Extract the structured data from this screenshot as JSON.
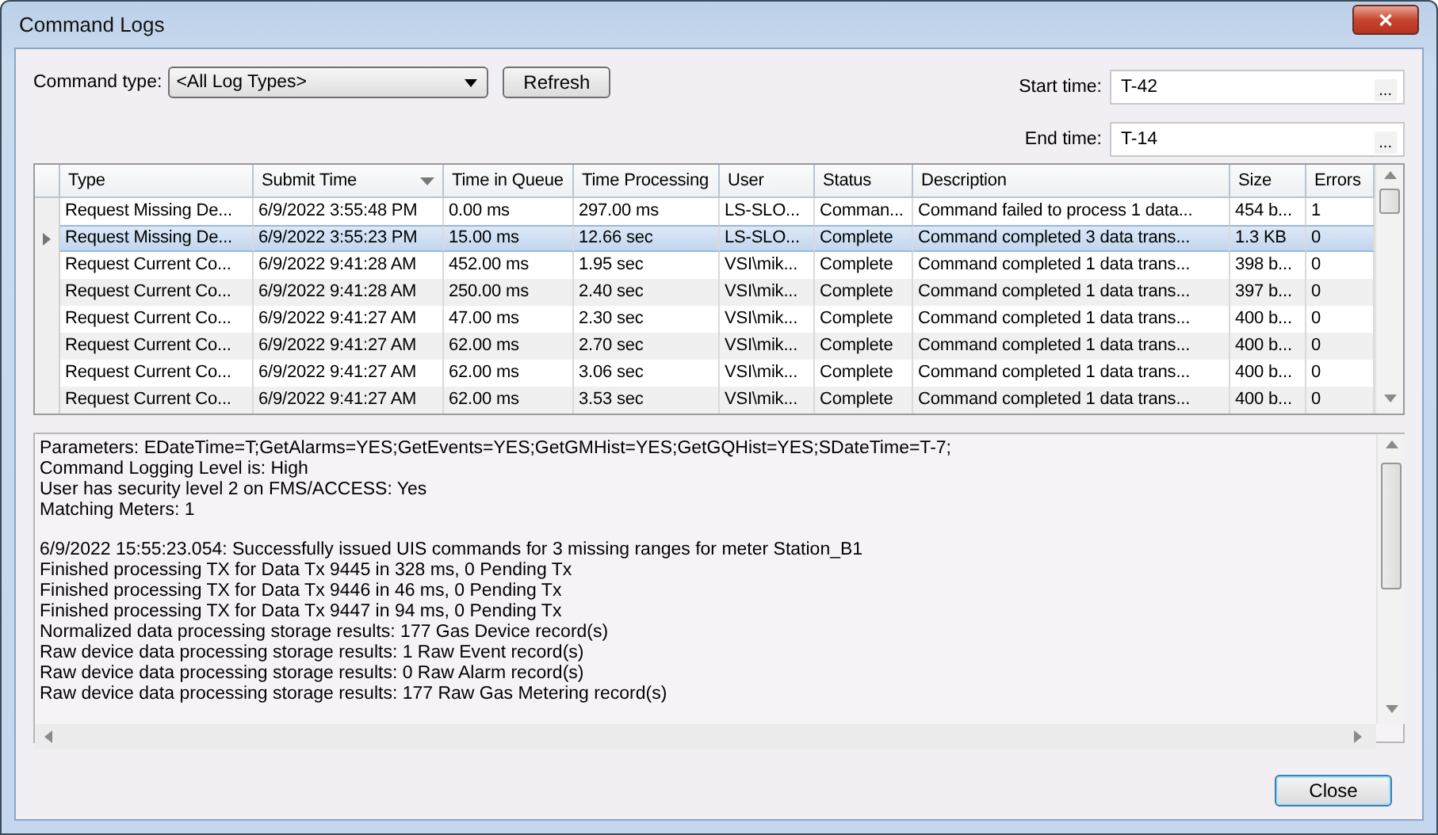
{
  "window": {
    "title": "Command Logs",
    "close_label": "✕"
  },
  "filters": {
    "command_type_label": "Command type:",
    "command_type_value": "<All Log Types>",
    "refresh": "Refresh",
    "start_label": "Start time:",
    "start_value": "T-42",
    "end_label": "End time:",
    "end_value": "T-14",
    "picker_label": "..."
  },
  "table": {
    "columns": [
      {
        "label": "Type",
        "sorted": false
      },
      {
        "label": "Submit Time",
        "sorted": true
      },
      {
        "label": "Time in Queue",
        "sorted": false
      },
      {
        "label": "Time Processing",
        "sorted": false
      },
      {
        "label": "User",
        "sorted": false
      },
      {
        "label": "Status",
        "sorted": false
      },
      {
        "label": "Description",
        "sorted": false
      },
      {
        "label": "Size",
        "sorted": false
      },
      {
        "label": "Errors",
        "sorted": false
      }
    ],
    "rows": [
      {
        "selected": false,
        "cells": [
          "Request Missing De...",
          "6/9/2022 3:55:48 PM",
          "0.00 ms",
          "297.00 ms",
          "LS-SLO...",
          "Comman...",
          "Command failed to process 1 data...",
          "454 b...",
          "1"
        ]
      },
      {
        "selected": true,
        "cells": [
          "Request Missing De...",
          "6/9/2022 3:55:23 PM",
          "15.00 ms",
          "12.66 sec",
          "LS-SLO...",
          "Complete",
          "Command completed 3 data trans...",
          "1.3 KB",
          "0"
        ]
      },
      {
        "selected": false,
        "cells": [
          "Request Current Co...",
          "6/9/2022 9:41:28 AM",
          "452.00 ms",
          "1.95 sec",
          "VSI\\mik...",
          "Complete",
          "Command completed 1 data trans...",
          "398 b...",
          "0"
        ]
      },
      {
        "selected": false,
        "cells": [
          "Request Current Co...",
          "6/9/2022 9:41:28 AM",
          "250.00 ms",
          "2.40 sec",
          "VSI\\mik...",
          "Complete",
          "Command completed 1 data trans...",
          "397 b...",
          "0"
        ]
      },
      {
        "selected": false,
        "cells": [
          "Request Current Co...",
          "6/9/2022 9:41:27 AM",
          "47.00 ms",
          "2.30 sec",
          "VSI\\mik...",
          "Complete",
          "Command completed 1 data trans...",
          "400 b...",
          "0"
        ]
      },
      {
        "selected": false,
        "cells": [
          "Request Current Co...",
          "6/9/2022 9:41:27 AM",
          "62.00 ms",
          "2.70 sec",
          "VSI\\mik...",
          "Complete",
          "Command completed 1 data trans...",
          "400 b...",
          "0"
        ]
      },
      {
        "selected": false,
        "cells": [
          "Request Current Co...",
          "6/9/2022 9:41:27 AM",
          "62.00 ms",
          "3.06 sec",
          "VSI\\mik...",
          "Complete",
          "Command completed 1 data trans...",
          "400 b...",
          "0"
        ]
      },
      {
        "selected": false,
        "cells": [
          "Request Current Co...",
          "6/9/2022 9:41:27 AM",
          "62.00 ms",
          "3.53 sec",
          "VSI\\mik...",
          "Complete",
          "Command completed 1 data trans...",
          "400 b...",
          "0"
        ]
      }
    ]
  },
  "log": {
    "paragraphs": [
      [
        "Parameters: EDateTime=T;GetAlarms=YES;GetEvents=YES;GetGMHist=YES;GetGQHist=YES;SDateTime=T-7;",
        "Command Logging Level is: High",
        "User has security level 2 on FMS/ACCESS: Yes",
        "Matching Meters: 1"
      ],
      [
        "6/9/2022 15:55:23.054: Successfully issued UIS commands for 3 missing ranges for meter Station_B1",
        "Finished processing TX for Data Tx 9445 in 328 ms, 0 Pending Tx",
        "Finished processing TX for Data Tx 9446 in 46 ms, 0 Pending Tx",
        "Finished processing TX for Data Tx 9447 in 94 ms, 0 Pending Tx",
        "Normalized data processing storage results: 177 Gas Device record(s)",
        "Raw device data processing storage results: 1 Raw Event record(s)",
        "Raw device data processing storage results: 0 Raw Alarm record(s)",
        "Raw device data processing storage results: 177 Raw Gas Metering record(s)"
      ]
    ]
  },
  "buttons": {
    "close": "Close"
  }
}
